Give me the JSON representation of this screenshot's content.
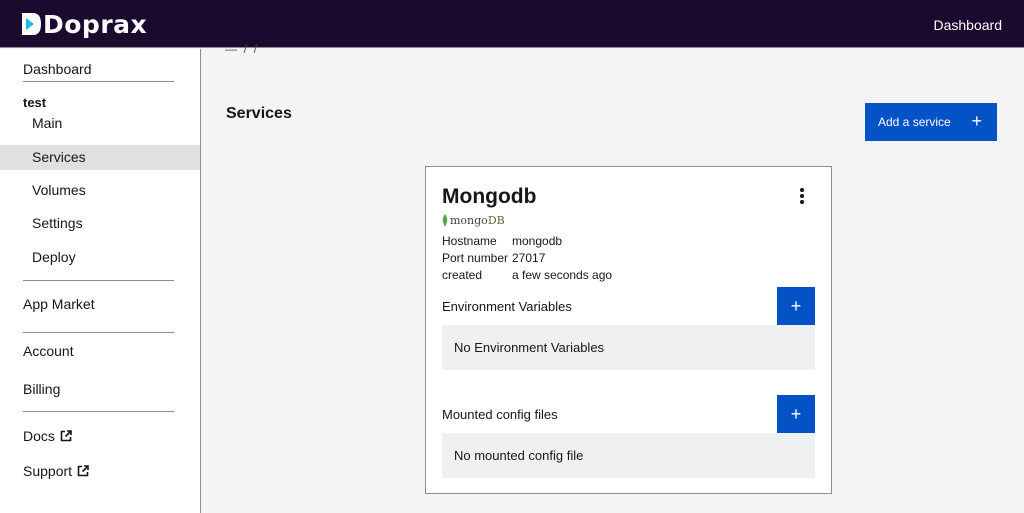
{
  "topbar": {
    "brand": "Doprax",
    "dashboard_link": "Dashboard"
  },
  "breadcrumb": "—  /  /",
  "sidebar": {
    "dashboard": "Dashboard",
    "project_name": "test",
    "project_items": [
      {
        "label": "Main"
      },
      {
        "label": "Services"
      },
      {
        "label": "Volumes"
      },
      {
        "label": "Settings"
      },
      {
        "label": "Deploy"
      }
    ],
    "app_market": "App Market",
    "account": "Account",
    "billing": "Billing",
    "docs": "Docs",
    "support": "Support"
  },
  "main": {
    "title": "Services",
    "add_service_label": "Add a service",
    "add_service_icon": "+"
  },
  "service": {
    "name": "Mongodb",
    "brand_text": "mongo",
    "brand_text_suffix": "DB",
    "info": [
      {
        "label": "Hostname",
        "value": "mongodb"
      },
      {
        "label": "Port number",
        "value": "27017"
      },
      {
        "label": "created",
        "value": "a few seconds ago"
      }
    ],
    "env": {
      "title": "Environment Variables",
      "empty_text": "No Environment Variables",
      "add_icon": "+"
    },
    "config": {
      "title": "Mounted config files",
      "empty_text": "No mounted config file",
      "add_icon": "+"
    }
  },
  "colors": {
    "topbar": "#1c0a2e",
    "primary": "#0353c6",
    "active_item": "#e0e0e0",
    "empty_box": "#eff0f2"
  }
}
